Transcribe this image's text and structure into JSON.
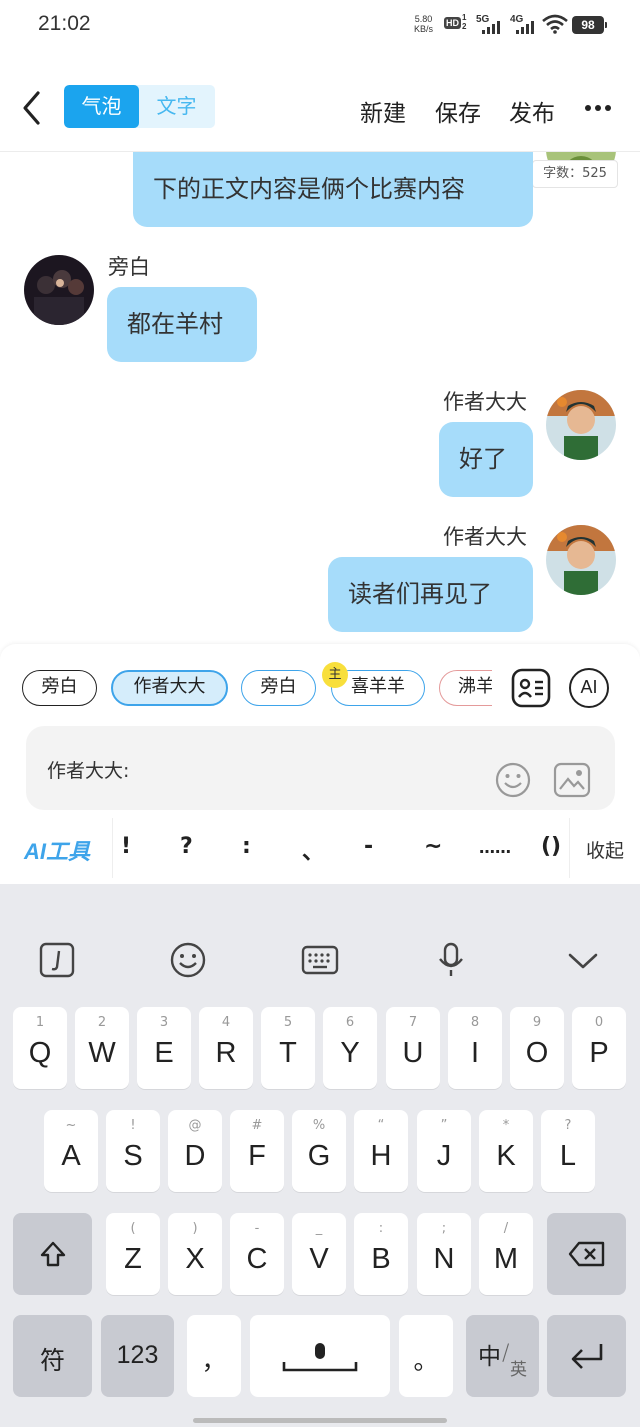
{
  "status_bar": {
    "time": "21:02",
    "speed_value": "5.80",
    "speed_unit": "KB/s",
    "hd": "HD",
    "hd_sub_top": "1",
    "hd_sub_bottom": "2",
    "net1": "5G",
    "net2": "4G",
    "battery": "98"
  },
  "header": {
    "back_icon": "chevron-left-icon",
    "tabs": [
      "气泡",
      "文字"
    ],
    "new_label": "新建",
    "save_label": "保存",
    "publish_label": "发布",
    "more_icon": "more-horizontal-icon"
  },
  "word_count": "字数：525",
  "messages": [
    {
      "side": "right",
      "name": "",
      "text": "下的正文内容是俩个比赛内容"
    },
    {
      "side": "left",
      "name": "旁白",
      "text": "都在羊村"
    },
    {
      "side": "right",
      "name": "作者大大",
      "text": "好了"
    },
    {
      "side": "right",
      "name": "作者大大",
      "text": "读者们再见了"
    }
  ],
  "characters": {
    "chips": [
      "旁白",
      "作者大大",
      "旁白",
      "喜羊羊",
      "沸羊"
    ],
    "selected": "作者大大",
    "master_badge": "主"
  },
  "ai_button": "AI",
  "input": {
    "prefix": "作者大大:"
  },
  "tools": {
    "ai_tool": "AI工具",
    "punctuation": [
      "!",
      "?",
      ":",
      "、",
      "-",
      "~",
      "……",
      "()"
    ],
    "collapse": "收起"
  },
  "keyboard": {
    "row1": [
      {
        "sub": "1",
        "main": "Q"
      },
      {
        "sub": "2",
        "main": "W"
      },
      {
        "sub": "3",
        "main": "E"
      },
      {
        "sub": "4",
        "main": "R"
      },
      {
        "sub": "5",
        "main": "T"
      },
      {
        "sub": "6",
        "main": "Y"
      },
      {
        "sub": "7",
        "main": "U"
      },
      {
        "sub": "8",
        "main": "I"
      },
      {
        "sub": "9",
        "main": "O"
      },
      {
        "sub": "0",
        "main": "P"
      }
    ],
    "row2": [
      {
        "sub": "~",
        "main": "A"
      },
      {
        "sub": "!",
        "main": "S"
      },
      {
        "sub": "@",
        "main": "D"
      },
      {
        "sub": "#",
        "main": "F"
      },
      {
        "sub": "%",
        "main": "G"
      },
      {
        "sub": "“",
        "main": "H"
      },
      {
        "sub": "”",
        "main": "J"
      },
      {
        "sub": "*",
        "main": "K"
      },
      {
        "sub": "?",
        "main": "L"
      }
    ],
    "row3": [
      {
        "sub": "(",
        "main": "Z"
      },
      {
        "sub": ")",
        "main": "X"
      },
      {
        "sub": "-",
        "main": "C"
      },
      {
        "sub": "_",
        "main": "V"
      },
      {
        "sub": ":",
        "main": "B"
      },
      {
        "sub": ";",
        "main": "N"
      },
      {
        "sub": "/",
        "main": "M"
      }
    ],
    "symbol_key": "符",
    "num_key": "123",
    "comma_key": "，",
    "period_key": "。",
    "lang_key_main": "中",
    "lang_key_sub": "英"
  },
  "colors": {
    "accent": "#1ba4ee",
    "bubble": "#a6dcfa",
    "keyboard_bg": "#e9eaee"
  }
}
